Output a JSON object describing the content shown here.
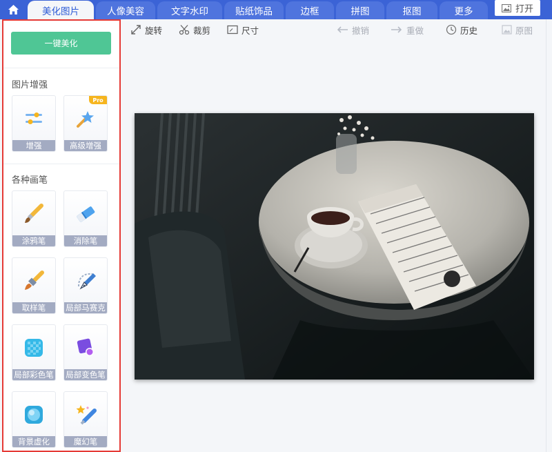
{
  "nav": {
    "tabs": [
      {
        "label": "美化图片",
        "active": true
      },
      {
        "label": "人像美容"
      },
      {
        "label": "文字水印"
      },
      {
        "label": "贴纸饰品"
      },
      {
        "label": "边框"
      },
      {
        "label": "拼图"
      },
      {
        "label": "抠图"
      },
      {
        "label": "更多"
      }
    ],
    "open_label": "打开"
  },
  "sidebar": {
    "one_key_label": "一键美化",
    "sections": [
      {
        "title": "图片增强",
        "tools": [
          {
            "label": "增强",
            "icon": "sliders-icon"
          },
          {
            "label": "高级增强",
            "icon": "magic-wand-icon",
            "badge": "Pro"
          }
        ]
      },
      {
        "title": "各种画笔",
        "tools": [
          {
            "label": "涂鸦笔",
            "icon": "paintbrush-icon"
          },
          {
            "label": "消除笔",
            "icon": "eraser-icon"
          },
          {
            "label": "取样笔",
            "icon": "sample-brush-icon"
          },
          {
            "label": "局部马赛克",
            "icon": "mosaic-pen-icon"
          },
          {
            "label": "局部彩色笔",
            "icon": "color-grid-icon"
          },
          {
            "label": "局部变色笔",
            "icon": "recolor-icon"
          },
          {
            "label": "背景虚化",
            "icon": "blur-icon"
          },
          {
            "label": "魔幻笔",
            "icon": "magic-pen-icon"
          }
        ]
      }
    ]
  },
  "toolbar": {
    "rotate": "旋转",
    "crop": "裁剪",
    "size": "尺寸",
    "undo": "撤销",
    "redo": "重做",
    "history": "历史",
    "original": "原图"
  },
  "colors": {
    "nav_bg": "#3b63d6",
    "accent_green": "#4fc695",
    "highlight_border": "#e53935",
    "pro_badge": "#f6b51e"
  }
}
